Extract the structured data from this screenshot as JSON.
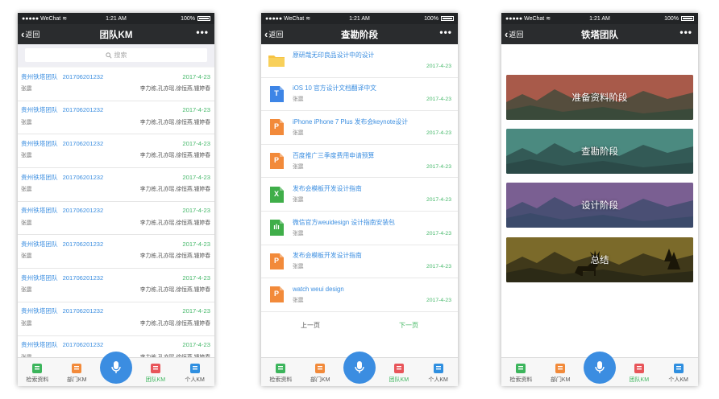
{
  "status_bar": {
    "carrier": "●●●●● WeChat",
    "time": "1:21 AM",
    "battery": "100%"
  },
  "common": {
    "back_label": "返回",
    "more_label": "•••",
    "tabs": [
      {
        "label": "检索资料",
        "icon": "search-doc-icon"
      },
      {
        "label": "部门KM",
        "icon": "department-icon"
      },
      {
        "label": "团队KM",
        "icon": "team-icon"
      },
      {
        "label": "个人KM",
        "icon": "personal-icon"
      }
    ],
    "colors": {
      "nav": "#2a2c2e",
      "link": "#3b8ee0",
      "green": "#45b86a",
      "mic": "#3b8de1"
    }
  },
  "screen1": {
    "title": "团队KM",
    "search_placeholder": "搜索",
    "rows": [
      {
        "team": "贵州铁塔团队",
        "code": "201706201232",
        "date": "2017-4-23",
        "owner": "张震",
        "members": "李力栋,孔亦瑶,徐恒燕,锺婷春"
      },
      {
        "team": "贵州铁塔团队",
        "code": "201706201232",
        "date": "2017-4-23",
        "owner": "张震",
        "members": "李力栋,孔亦瑶,徐恒燕,锺婷春"
      },
      {
        "team": "贵州铁塔团队",
        "code": "201706201232",
        "date": "2017-4-23",
        "owner": "张震",
        "members": "李力栋,孔亦瑶,徐恒燕,锺婷春"
      },
      {
        "team": "贵州铁塔团队",
        "code": "201706201232",
        "date": "2017-4-23",
        "owner": "张震",
        "members": "李力栋,孔亦瑶,徐恒燕,锺婷春"
      },
      {
        "team": "贵州铁塔团队",
        "code": "201706201232",
        "date": "2017-4-23",
        "owner": "张震",
        "members": "李力栋,孔亦瑶,徐恒燕,锺婷春"
      },
      {
        "team": "贵州铁塔团队",
        "code": "201706201232",
        "date": "2017-4-23",
        "owner": "张震",
        "members": "李力栋,孔亦瑶,徐恒燕,锺婷春"
      },
      {
        "team": "贵州铁塔团队",
        "code": "201706201232",
        "date": "2017-4-23",
        "owner": "张震",
        "members": "李力栋,孔亦瑶,徐恒燕,锺婷春"
      },
      {
        "team": "贵州铁塔团队",
        "code": "201706201232",
        "date": "2017-4-23",
        "owner": "张震",
        "members": "李力栋,孔亦瑶,徐恒燕,锺婷春"
      },
      {
        "team": "贵州铁塔团队",
        "code": "201706201232",
        "date": "2017-4-23",
        "owner": "张震",
        "members": "李力栋,孔亦瑶,徐恒燕,锺婷春"
      }
    ]
  },
  "screen2": {
    "title": "查勘阶段",
    "files": [
      {
        "name": "原研哉无印良品设计中的设计",
        "owner": "",
        "date": "2017-4-23",
        "type": "folder",
        "color": "#f6c343",
        "glyph": ""
      },
      {
        "name": "iOS 10 官方设计文档翻译中文",
        "owner": "张震",
        "date": "2017-4-23",
        "type": "doc",
        "color": "#3d85e6",
        "glyph": "T"
      },
      {
        "name": "iPhone iPhone 7 Plus 发布会keynote设计",
        "owner": "张震",
        "date": "2017-4-23",
        "type": "ppt",
        "color": "#f28a3a",
        "glyph": "P"
      },
      {
        "name": "百度推广三季度费用申请预算",
        "owner": "张震",
        "date": "2017-4-23",
        "type": "ppt",
        "color": "#f28a3a",
        "glyph": "P"
      },
      {
        "name": "发布会模板开发设计指南",
        "owner": "张震",
        "date": "2017-4-23",
        "type": "xls",
        "color": "#3fae49",
        "glyph": "X"
      },
      {
        "name": "微信官方weuidesign 设计指南安装包",
        "owner": "张震",
        "date": "2017-4-23",
        "type": "chart",
        "color": "#3fae49",
        "glyph": "ılı"
      },
      {
        "name": "发布会模板开发设计指南",
        "owner": "张震",
        "date": "2017-4-23",
        "type": "ppt",
        "color": "#f28a3a",
        "glyph": "P"
      },
      {
        "name": "watch weui design",
        "owner": "张震",
        "date": "2017-4-23",
        "type": "ppt",
        "color": "#f28a3a",
        "glyph": "P"
      }
    ],
    "prev_label": "上一页",
    "next_label": "下一页"
  },
  "screen3": {
    "title": "铁塔团队",
    "stages": [
      {
        "label": "准备资料阶段",
        "sky": "#a85a4a",
        "ground": "#3a4a3a"
      },
      {
        "label": "查勘阶段",
        "sky": "#4b8a80",
        "ground": "#2b4a48"
      },
      {
        "label": "设计阶段",
        "sky": "#7a5f92",
        "ground": "#3b4a6a"
      },
      {
        "label": "总结",
        "sky": "#7b6a2a",
        "ground": "#2c2a16"
      }
    ]
  }
}
